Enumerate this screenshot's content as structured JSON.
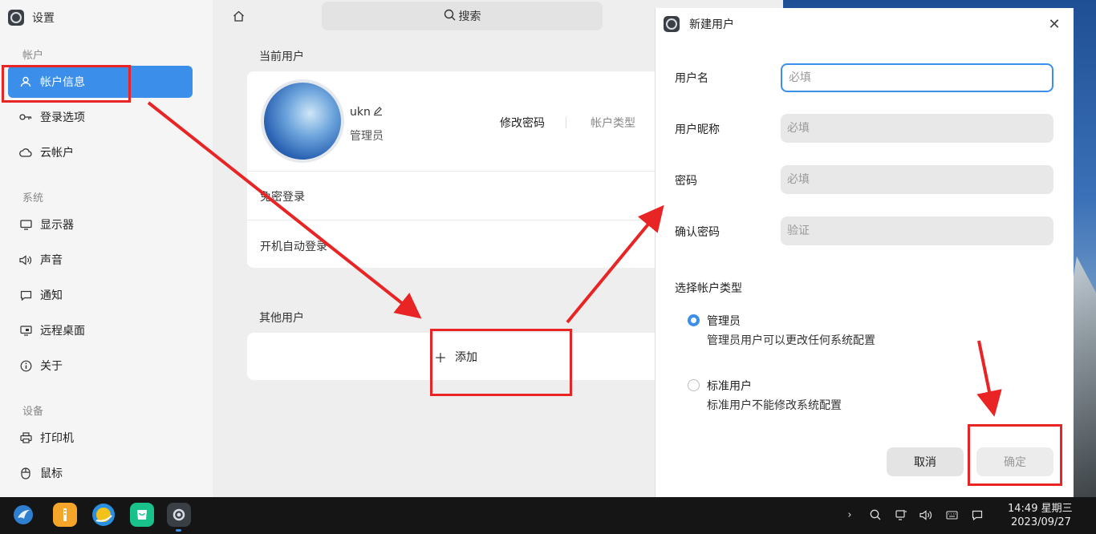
{
  "app": {
    "title": "设置"
  },
  "sidebar": {
    "groups": [
      {
        "label": "帐户"
      },
      {
        "label": "系统"
      },
      {
        "label": "设备"
      }
    ],
    "items": [
      {
        "label": "帐户信息",
        "icon": "user-icon",
        "active": true
      },
      {
        "label": "登录选项",
        "icon": "key-icon"
      },
      {
        "label": "云帐户",
        "icon": "cloud-icon"
      },
      {
        "label": "显示器",
        "icon": "monitor-icon"
      },
      {
        "label": "声音",
        "icon": "speaker-icon"
      },
      {
        "label": "通知",
        "icon": "notification-icon"
      },
      {
        "label": "远程桌面",
        "icon": "remote-desktop-icon"
      },
      {
        "label": "关于",
        "icon": "info-icon"
      },
      {
        "label": "打印机",
        "icon": "printer-icon"
      },
      {
        "label": "鼠标",
        "icon": "mouse-icon"
      }
    ]
  },
  "search": {
    "placeholder": "搜索"
  },
  "current_user": {
    "section": "当前用户",
    "username": "ukn",
    "role": "管理员",
    "change_password": "修改密码",
    "account_type": "帐户类型",
    "passwordless_login": "免密登录",
    "auto_login": "开机自动登录"
  },
  "other_users": {
    "section": "其他用户",
    "add_label": "添加"
  },
  "dialog": {
    "title": "新建用户",
    "fields": [
      {
        "label": "用户名",
        "placeholder": "必填"
      },
      {
        "label": "用户昵称",
        "placeholder": "必填"
      },
      {
        "label": "密码",
        "placeholder": "必填"
      },
      {
        "label": "确认密码",
        "placeholder": "验证"
      }
    ],
    "type_heading": "选择帐户类型",
    "types": [
      {
        "title": "管理员",
        "desc": "管理员用户可以更改任何系统配置",
        "checked": true
      },
      {
        "title": "标准用户",
        "desc": "标准用户不能修改系统配置",
        "checked": false
      }
    ],
    "cancel": "取消",
    "confirm": "确定"
  },
  "taskbar": {
    "time": "14:49 星期三",
    "date": "2023/09/27"
  },
  "colors": {
    "accent": "#3b8eea",
    "annotation": "#e82424"
  }
}
